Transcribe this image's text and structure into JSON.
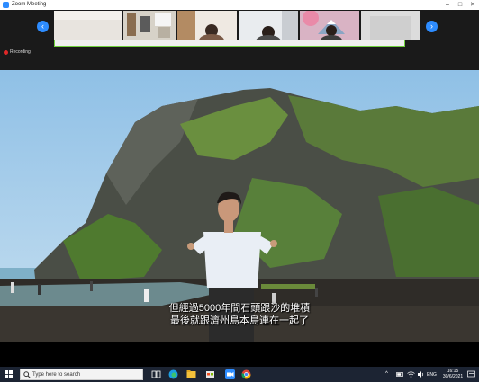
{
  "window": {
    "title": "Zoom Meeting"
  },
  "gallery": {
    "tiles": 6
  },
  "recording": {
    "label": "Recording"
  },
  "caption": {
    "line1": "但經過5000年間石頭跟沙的堆積",
    "line2": "最後就跟濟州島本島連在一起了"
  },
  "taskbar": {
    "search_placeholder": "Type here to search",
    "language": "ENG",
    "time": "16:15",
    "date": "30/6/2021"
  },
  "colors": {
    "zoom_blue": "#2d8cff",
    "speaker_outline": "#6fcf3d",
    "record_red": "#e02828"
  }
}
